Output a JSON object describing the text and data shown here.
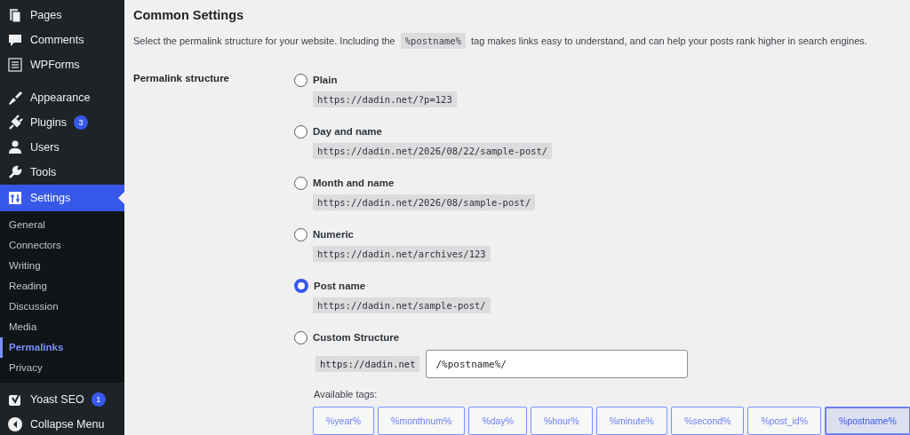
{
  "sidebar": {
    "menu": [
      {
        "kind": "pages",
        "label": "Pages",
        "selected": false
      },
      {
        "kind": "comments",
        "label": "Comments",
        "selected": false
      },
      {
        "kind": "forms",
        "label": "WPForms",
        "selected": false
      },
      {
        "kind": "appearance",
        "label": "Appearance",
        "selected": false
      },
      {
        "kind": "plugins",
        "label": "Plugins",
        "badge": "3",
        "selected": false
      },
      {
        "kind": "users",
        "label": "Users",
        "selected": false
      },
      {
        "kind": "tools",
        "label": "Tools",
        "selected": false
      },
      {
        "kind": "settings",
        "label": "Settings",
        "selected": true,
        "children": [
          {
            "label": "General",
            "selected": false
          },
          {
            "label": "Connectors",
            "selected": false
          },
          {
            "label": "Writing",
            "selected": false
          },
          {
            "label": "Reading",
            "selected": false
          },
          {
            "label": "Discussion",
            "selected": false
          },
          {
            "label": "Media",
            "selected": false
          },
          {
            "label": "Permalinks",
            "selected": true
          },
          {
            "label": "Privacy",
            "selected": false
          }
        ]
      },
      {
        "kind": "yoast",
        "label": "Yoast SEO",
        "badge": "1",
        "selected": false
      },
      {
        "kind": "collapse",
        "label": "Collapse Menu",
        "selected": false
      }
    ]
  },
  "main": {
    "title": "Common Settings",
    "description": {
      "before": "Select the permalink structure for your website. Including the",
      "code": "%postname%",
      "after": "tag makes links easy to understand, and can help your posts rank higher in search engines."
    },
    "field_label": "Permalink structure",
    "options": [
      {
        "label": "Plain",
        "example": "https://dadin.net/?p=123",
        "selected": false
      },
      {
        "label": "Day and name",
        "example": "https://dadin.net/2026/08/22/sample-post/",
        "selected": false
      },
      {
        "label": "Month and name",
        "example": "https://dadin.net/2026/08/sample-post/",
        "selected": false
      },
      {
        "label": "Numeric",
        "example": "https://dadin.net/archives/123",
        "selected": false
      },
      {
        "label": "Post name",
        "example": "https://dadin.net/sample-post/",
        "selected": true
      }
    ],
    "custom": {
      "label": "Custom Structure",
      "selected": false,
      "prefix": "https://dadin.net",
      "value": "/%postname%/"
    },
    "tags_label": "Available tags:",
    "tags": [
      {
        "label": "%year%",
        "selected": false
      },
      {
        "label": "%monthnum%",
        "selected": false
      },
      {
        "label": "%day%",
        "selected": false
      },
      {
        "label": "%hour%",
        "selected": false
      },
      {
        "label": "%minute%",
        "selected": false
      },
      {
        "label": "%second%",
        "selected": false
      },
      {
        "label": "%post_id%",
        "selected": false
      },
      {
        "label": "%postname%",
        "selected": true
      }
    ]
  }
}
